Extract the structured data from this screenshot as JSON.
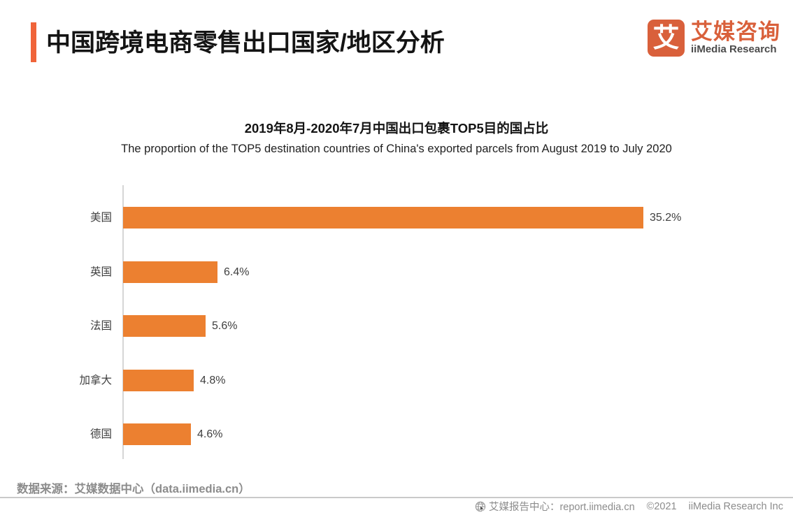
{
  "header": {
    "title": "中国跨境电商零售出口国家/地区分析",
    "accent_color": "#F0643A",
    "logo": {
      "mark_char": "艾",
      "cn_name": "艾媒咨询",
      "en_name": "iiMedia Research",
      "color": "#D9603B"
    }
  },
  "chart_data": {
    "type": "bar",
    "orientation": "horizontal",
    "title": "2019年8月-2020年7月中国出口包裹TOP5目的国占比",
    "subtitle": "The proportion of the TOP5 destination countries of China's exported parcels from August 2019 to July 2020",
    "categories": [
      "美国",
      "英国",
      "法国",
      "加拿大",
      "德国"
    ],
    "values": [
      35.2,
      6.4,
      5.6,
      4.8,
      4.6
    ],
    "value_labels": [
      "35.2%",
      "6.4%",
      "5.6%",
      "4.8%",
      "4.6%"
    ],
    "xlabel": "",
    "ylabel": "",
    "xlim": [
      0,
      35.2
    ],
    "grid": false,
    "legend": false,
    "bar_color": "#EC8030",
    "axis_color": "#D6D6D6"
  },
  "footer": {
    "source": "数据来源：艾媒数据中心（data.iimedia.cn）",
    "report_center": "艾媒报告中心：report.iimedia.cn",
    "copyright": "©2021",
    "company": "iiMedia Research  Inc",
    "globe_icon": "globe-icon"
  }
}
